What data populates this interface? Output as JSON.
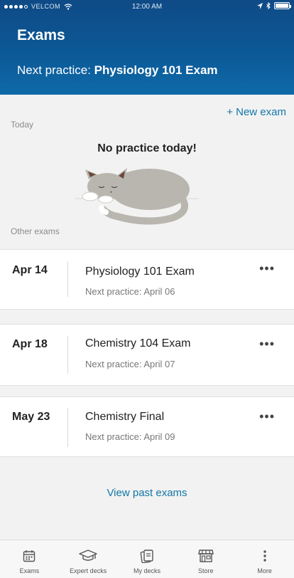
{
  "status_bar": {
    "carrier": "VELCOM",
    "time": "12:00 AM"
  },
  "header": {
    "title": "Exams",
    "next_prefix": "Next practice: ",
    "next_exam": "Physiology 101 Exam"
  },
  "actions": {
    "new_exam": "+ New exam",
    "view_past": "View past exams"
  },
  "today": {
    "label": "Today",
    "empty_message": "No practice today!"
  },
  "other_label": "Other exams",
  "exams": [
    {
      "date": "Apr 14",
      "name": "Physiology 101 Exam",
      "next": "Next practice: April 06"
    },
    {
      "date": "Apr 18",
      "name": "Chemistry 104 Exam",
      "next": "Next practice: April 07"
    },
    {
      "date": "May 23",
      "name": "Chemistry Final",
      "next": "Next practice: April 09"
    }
  ],
  "tabs": [
    {
      "label": "Exams",
      "icon": "calendar-icon"
    },
    {
      "label": "Expert decks",
      "icon": "graduation-cap-icon"
    },
    {
      "label": "My decks",
      "icon": "cards-icon"
    },
    {
      "label": "Store",
      "icon": "store-icon"
    },
    {
      "label": "More",
      "icon": "more-vertical-icon"
    }
  ],
  "colors": {
    "header": "#0e4a86",
    "accent": "#1177a8",
    "background": "#f2f2f2"
  }
}
